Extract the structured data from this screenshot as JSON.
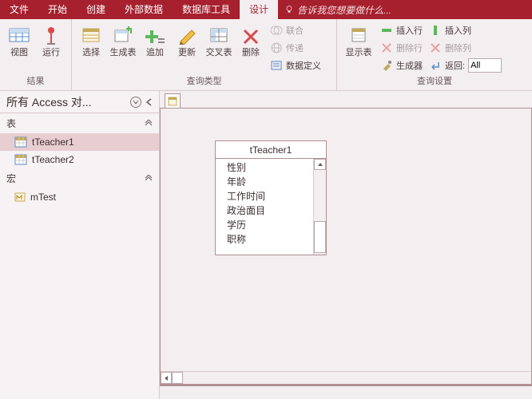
{
  "menubar": {
    "tabs": [
      "文件",
      "开始",
      "创建",
      "外部数据",
      "数据库工具",
      "设计"
    ],
    "active_index": 5,
    "tell_me": "告诉我您想要做什么..."
  },
  "ribbon": {
    "groups": {
      "results": {
        "label": "结果",
        "view": "视图",
        "run": "运行"
      },
      "query_type": {
        "label": "查询类型",
        "select": "选择",
        "make_table": "生成表",
        "append": "追加",
        "update": "更新",
        "crosstab": "交叉表",
        "delete": "删除",
        "union": "联合",
        "passthrough": "传递",
        "data_def": "数据定义"
      },
      "query_setup": {
        "label": "查询设置",
        "show_table": "显示表",
        "insert_row": "插入行",
        "delete_row": "删除行",
        "builder": "生成器",
        "insert_col": "插入列",
        "delete_col": "删除列",
        "return": "返回:",
        "return_value": "All"
      }
    }
  },
  "nav": {
    "title": "所有 Access 对...",
    "sections": {
      "tables": "表",
      "macros": "宏"
    },
    "tables": [
      {
        "name": "tTeacher1",
        "selected": true
      },
      {
        "name": "tTeacher2",
        "selected": false
      }
    ],
    "macros": [
      {
        "name": "mTest"
      }
    ]
  },
  "design": {
    "table_name": "tTeacher1",
    "fields": [
      "性别",
      "年龄",
      "工作时间",
      "政治面目",
      "学历",
      "职称"
    ]
  }
}
